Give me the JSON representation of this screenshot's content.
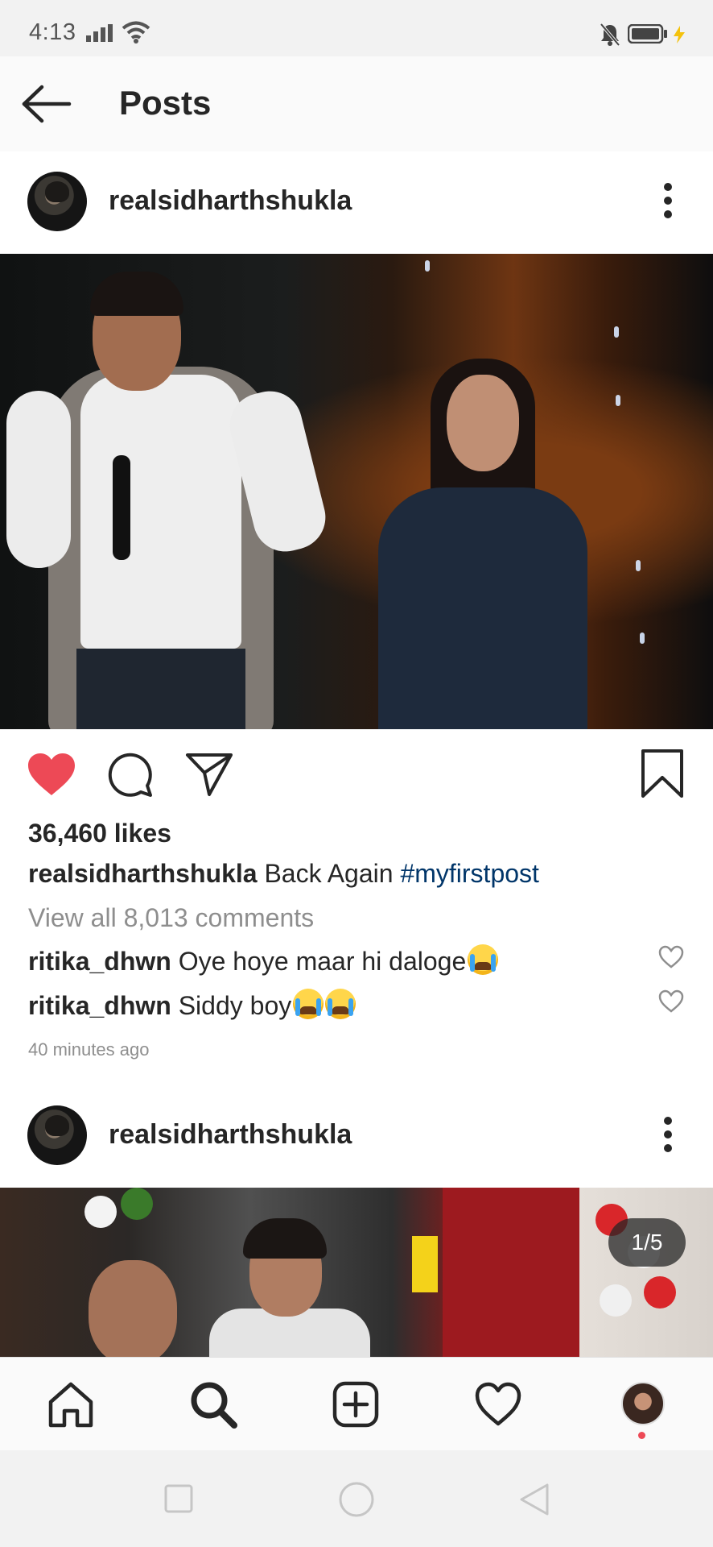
{
  "status_bar": {
    "time": "4:13"
  },
  "header": {
    "title": "Posts"
  },
  "posts": [
    {
      "username": "realsidharthshukla",
      "likes": "36,460 likes",
      "caption_user": "realsidharthshukla",
      "caption_text": "Back Again",
      "caption_hashtag": "#myfirstpost",
      "view_all": "View all 8,013 comments",
      "comments": [
        {
          "user": "ritika_dhwn",
          "text": "Oye hoye maar hi daloge"
        },
        {
          "user": "ritika_dhwn",
          "text": "Siddy boy"
        }
      ],
      "time_ago": "40 minutes ago",
      "liked": true
    },
    {
      "username": "realsidharthshukla",
      "carousel_counter": "1/5"
    }
  ],
  "colors": {
    "like_red": "#ed4956",
    "hashtag_blue": "#003569",
    "muted_gray": "#8e8e8e"
  },
  "icons": {
    "actions": [
      "heart-filled-icon",
      "comment-icon",
      "share-icon",
      "bookmark-icon"
    ],
    "bottom_nav": [
      "home-icon",
      "search-icon",
      "add-post-icon",
      "activity-heart-icon",
      "profile-avatar"
    ],
    "system_nav": [
      "recent-apps-icon",
      "home-circle-icon",
      "back-triangle-icon"
    ]
  }
}
